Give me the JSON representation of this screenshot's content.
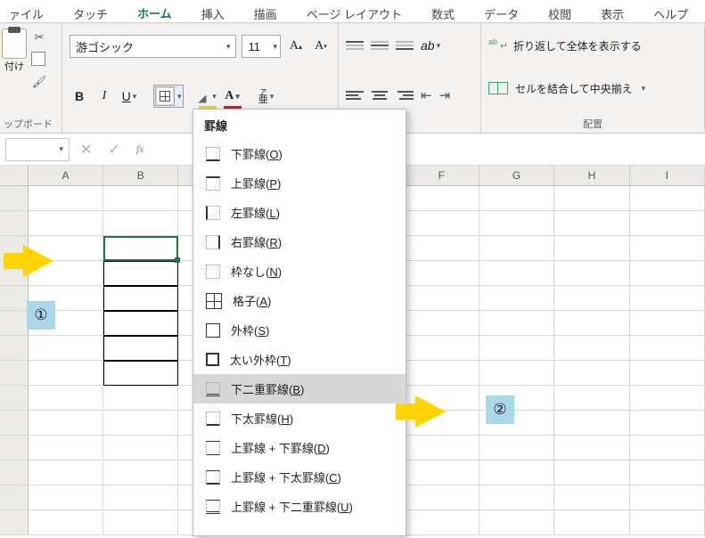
{
  "tabs": {
    "file": "ァイル",
    "touch": "タッチ",
    "home": "ホーム",
    "insert": "挿入",
    "draw": "描画",
    "layout": "ページ レイアウト",
    "formulas": "数式",
    "data": "データ",
    "review": "校閲",
    "view": "表示",
    "help": "ヘルプ"
  },
  "clipboard": {
    "paste_label": "付け",
    "group_label": "ップボード"
  },
  "font": {
    "name": "游ゴシック",
    "size": "11",
    "furigana_top": "ア",
    "furigana_bottom": "亜"
  },
  "align": {
    "orient_chev": "▾"
  },
  "wrap": {
    "wrap_label": "折り返して全体を表示する",
    "merge_label": "セルを結合して中央揃え",
    "group_label": "配置"
  },
  "columns": [
    "A",
    "B",
    "",
    "",
    "",
    "F",
    "G",
    "H",
    "I"
  ],
  "dropdown": {
    "title": "罫線",
    "items": [
      {
        "pre": "下罫線(",
        "u": "O",
        "post": ")"
      },
      {
        "pre": "上罫線(",
        "u": "P",
        "post": ")"
      },
      {
        "pre": "左罫線(",
        "u": "L",
        "post": ")"
      },
      {
        "pre": "右罫線(",
        "u": "R",
        "post": ")"
      },
      {
        "pre": "枠なし(",
        "u": "N",
        "post": ")"
      },
      {
        "pre": "格子(",
        "u": "A",
        "post": ")"
      },
      {
        "pre": "外枠(",
        "u": "S",
        "post": ")"
      },
      {
        "pre": "太い外枠(",
        "u": "T",
        "post": ")"
      },
      {
        "pre": "下二重罫線(",
        "u": "B",
        "post": ")",
        "selected": true
      },
      {
        "pre": "下太罫線(",
        "u": "H",
        "post": ")"
      },
      {
        "pre": "上罫線 + 下罫線(",
        "u": "D",
        "post": ")"
      },
      {
        "pre": "上罫線 + 下太罫線(",
        "u": "C",
        "post": ")"
      },
      {
        "pre": "上罫線 + 下二重罫線(",
        "u": "U",
        "post": ")"
      }
    ]
  },
  "annotations": {
    "badge1": "①",
    "badge2": "②"
  }
}
